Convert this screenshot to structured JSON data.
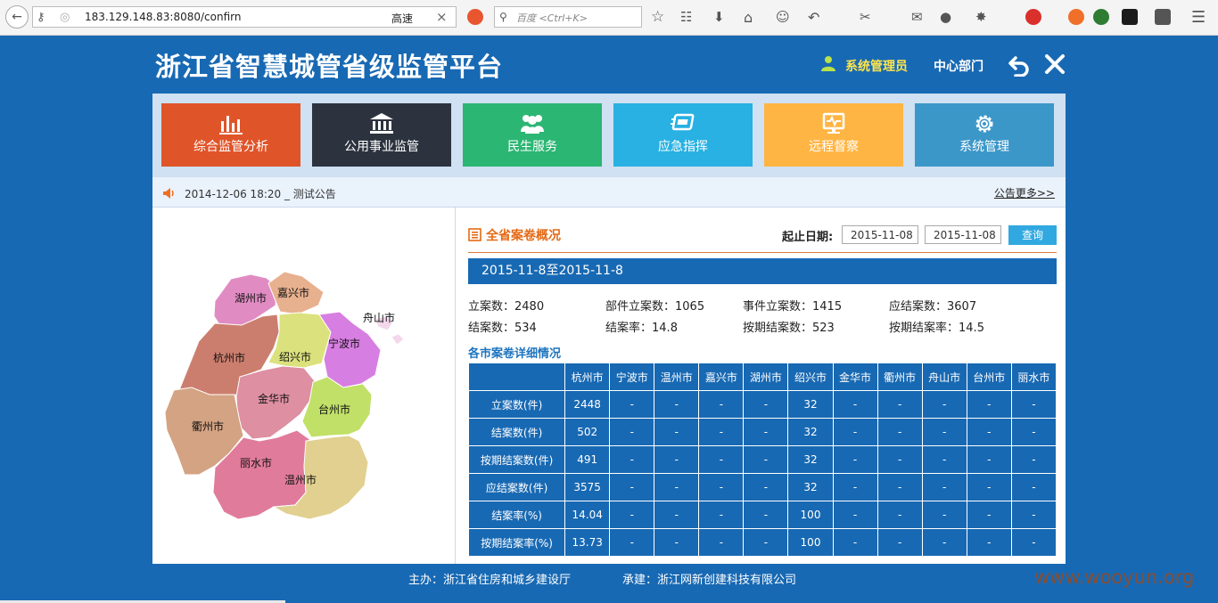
{
  "browser": {
    "url": "183.129.148.83:8080/confirn",
    "speed_label": "高速",
    "search_placeholder": "百度 <Ctrl+K>"
  },
  "header": {
    "title": "浙江省智慧城管省级监管平台",
    "user": "系统管理员",
    "dept": "中心部门"
  },
  "nav": [
    {
      "label": "综合监管分析",
      "icon": "bar-chart-icon",
      "color": "#e05429"
    },
    {
      "label": "公用事业监管",
      "icon": "bank-icon",
      "color": "#2c333f"
    },
    {
      "label": "民生服务",
      "icon": "people-icon",
      "color": "#2bb673"
    },
    {
      "label": "应急指挥",
      "icon": "command-icon",
      "color": "#28b1e2"
    },
    {
      "label": "远程督察",
      "icon": "monitor-icon",
      "color": "#ffb544"
    },
    {
      "label": "系统管理",
      "icon": "gear-icon",
      "color": "#3c97c9"
    }
  ],
  "notice": {
    "text": "2014-12-06 18:20 _ 测试公告",
    "more": "公告更多>>"
  },
  "map": {
    "cities": [
      "湖州市",
      "嘉兴市",
      "舟山市",
      "宁波市",
      "杭州市",
      "绍兴市",
      "金华市",
      "台州市",
      "衢州市",
      "丽水市",
      "温州市"
    ]
  },
  "overview": {
    "title": "全省案卷概况",
    "date_label": "起止日期:",
    "start_date": "2015-11-08",
    "end_date": "2015-11-08",
    "query": "查询",
    "range": "2015-11-8至2015-11-8",
    "stats": [
      {
        "label": "立案数：",
        "value": "2480"
      },
      {
        "label": "部件立案数：",
        "value": "1065"
      },
      {
        "label": "事件立案数：",
        "value": "1415"
      },
      {
        "label": "应结案数：",
        "value": "3607"
      },
      {
        "label": "结案数：",
        "value": "534"
      },
      {
        "label": "结案率：",
        "value": "14.8"
      },
      {
        "label": "按期结案数：",
        "value": "523"
      },
      {
        "label": "按期结案率：",
        "value": "14.5"
      }
    ]
  },
  "detail": {
    "title": "各市案卷详细情况",
    "columns": [
      "杭州市",
      "宁波市",
      "温州市",
      "嘉兴市",
      "湖州市",
      "绍兴市",
      "金华市",
      "衢州市",
      "舟山市",
      "台州市",
      "丽水市"
    ],
    "rows": [
      {
        "label": "立案数(件)",
        "values": [
          "2448",
          "-",
          "-",
          "-",
          "-",
          "32",
          "-",
          "-",
          "-",
          "-",
          "-"
        ]
      },
      {
        "label": "结案数(件)",
        "values": [
          "502",
          "-",
          "-",
          "-",
          "-",
          "32",
          "-",
          "-",
          "-",
          "-",
          "-"
        ]
      },
      {
        "label": "按期结案数(件)",
        "values": [
          "491",
          "-",
          "-",
          "-",
          "-",
          "32",
          "-",
          "-",
          "-",
          "-",
          "-"
        ]
      },
      {
        "label": "应结案数(件)",
        "values": [
          "3575",
          "-",
          "-",
          "-",
          "-",
          "32",
          "-",
          "-",
          "-",
          "-",
          "-"
        ]
      },
      {
        "label": "结案率(%)",
        "values": [
          "14.04",
          "-",
          "-",
          "-",
          "-",
          "100",
          "-",
          "-",
          "-",
          "-",
          "-"
        ]
      },
      {
        "label": "按期结案率(%)",
        "values": [
          "13.73",
          "-",
          "-",
          "-",
          "-",
          "100",
          "-",
          "-",
          "-",
          "-",
          "-"
        ]
      }
    ]
  },
  "footer": {
    "sponsor": "主办：浙江省住房和城乡建设厅",
    "undertaker": "承建：浙江网新创建科技有限公司",
    "watermark": "www.wooyun.org"
  }
}
